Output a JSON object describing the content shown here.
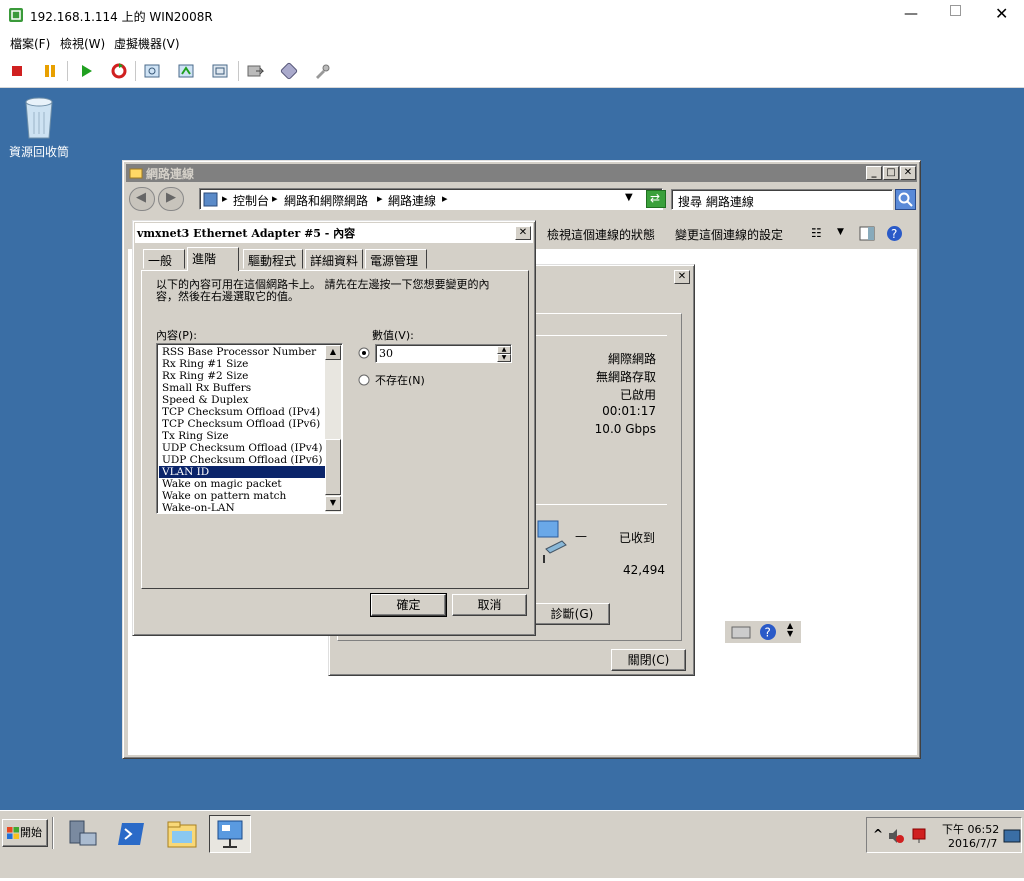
{
  "host": {
    "title": "192.168.1.114 上的 WIN2008R",
    "menu": [
      "檔案(F)",
      "檢視(W)",
      "虛擬機器(V)"
    ],
    "toolbar_icons": [
      "stop-icon",
      "pause-icon",
      "play-icon",
      "reset-icon",
      "snapshot-icon",
      "revert-snapshot-icon",
      "snapshot-manager-icon",
      "console-icon",
      "vm-settings-icon",
      "tools-icon"
    ],
    "colors": {
      "stop": "#d02020",
      "pause": "#e8a000",
      "play": "#20a020",
      "desktop": "#3a6ea5",
      "selection": "#0a246a"
    }
  },
  "desktop": {
    "recycle_bin_label": "資源回收筒"
  },
  "network_connections": {
    "title": "網路連線",
    "breadcrumb": [
      "控制台",
      "網路和網際網路",
      "網路連線"
    ],
    "search_placeholder": "搜尋 網路連線",
    "commands": [
      "檢視這個連線的狀態",
      "變更這個連線的設定"
    ]
  },
  "status_dialog": {
    "rows": [
      "網際網路",
      "無網路存取",
      "已啟用",
      "00:01:17",
      "10.0 Gbps"
    ],
    "received_label": "已收到",
    "received_value": "42,494",
    "dash": "—",
    "diagnose_button": "診斷(G)",
    "close_button": "關閉(C)"
  },
  "properties_dialog": {
    "title": "vmxnet3 Ethernet Adapter #5 - 內容",
    "tabs": [
      "一般",
      "進階",
      "驅動程式",
      "詳細資料",
      "電源管理"
    ],
    "active_tab": "進階",
    "description": "以下的內容可用在這個網路卡上。 請先在左邊按一下您想要變更的內容，然後在右邊選取它的值。",
    "property_label": "內容(P):",
    "value_label": "數值(V):",
    "properties": [
      "RSS Base Processor Number",
      "Rx Ring #1 Size",
      "Rx Ring #2 Size",
      "Small Rx Buffers",
      "Speed & Duplex",
      "TCP Checksum Offload (IPv4)",
      "TCP Checksum Offload (IPv6)",
      "Tx Ring Size",
      "UDP Checksum Offload (IPv4)",
      "UDP Checksum Offload (IPv6)",
      "VLAN ID",
      "Wake on magic packet",
      "Wake on pattern match",
      "Wake-on-LAN"
    ],
    "selected_property": "VLAN ID",
    "value": "30",
    "not_present_label": "不存在(N)",
    "ok_button": "確定",
    "cancel_button": "取消"
  },
  "taskbar": {
    "start_label": "開始",
    "apps": [
      "server-manager-icon",
      "powershell-icon",
      "explorer-icon",
      "network-icon"
    ],
    "clock_time": "下午 06:52",
    "clock_date": "2016/7/7",
    "chevron": "^"
  }
}
